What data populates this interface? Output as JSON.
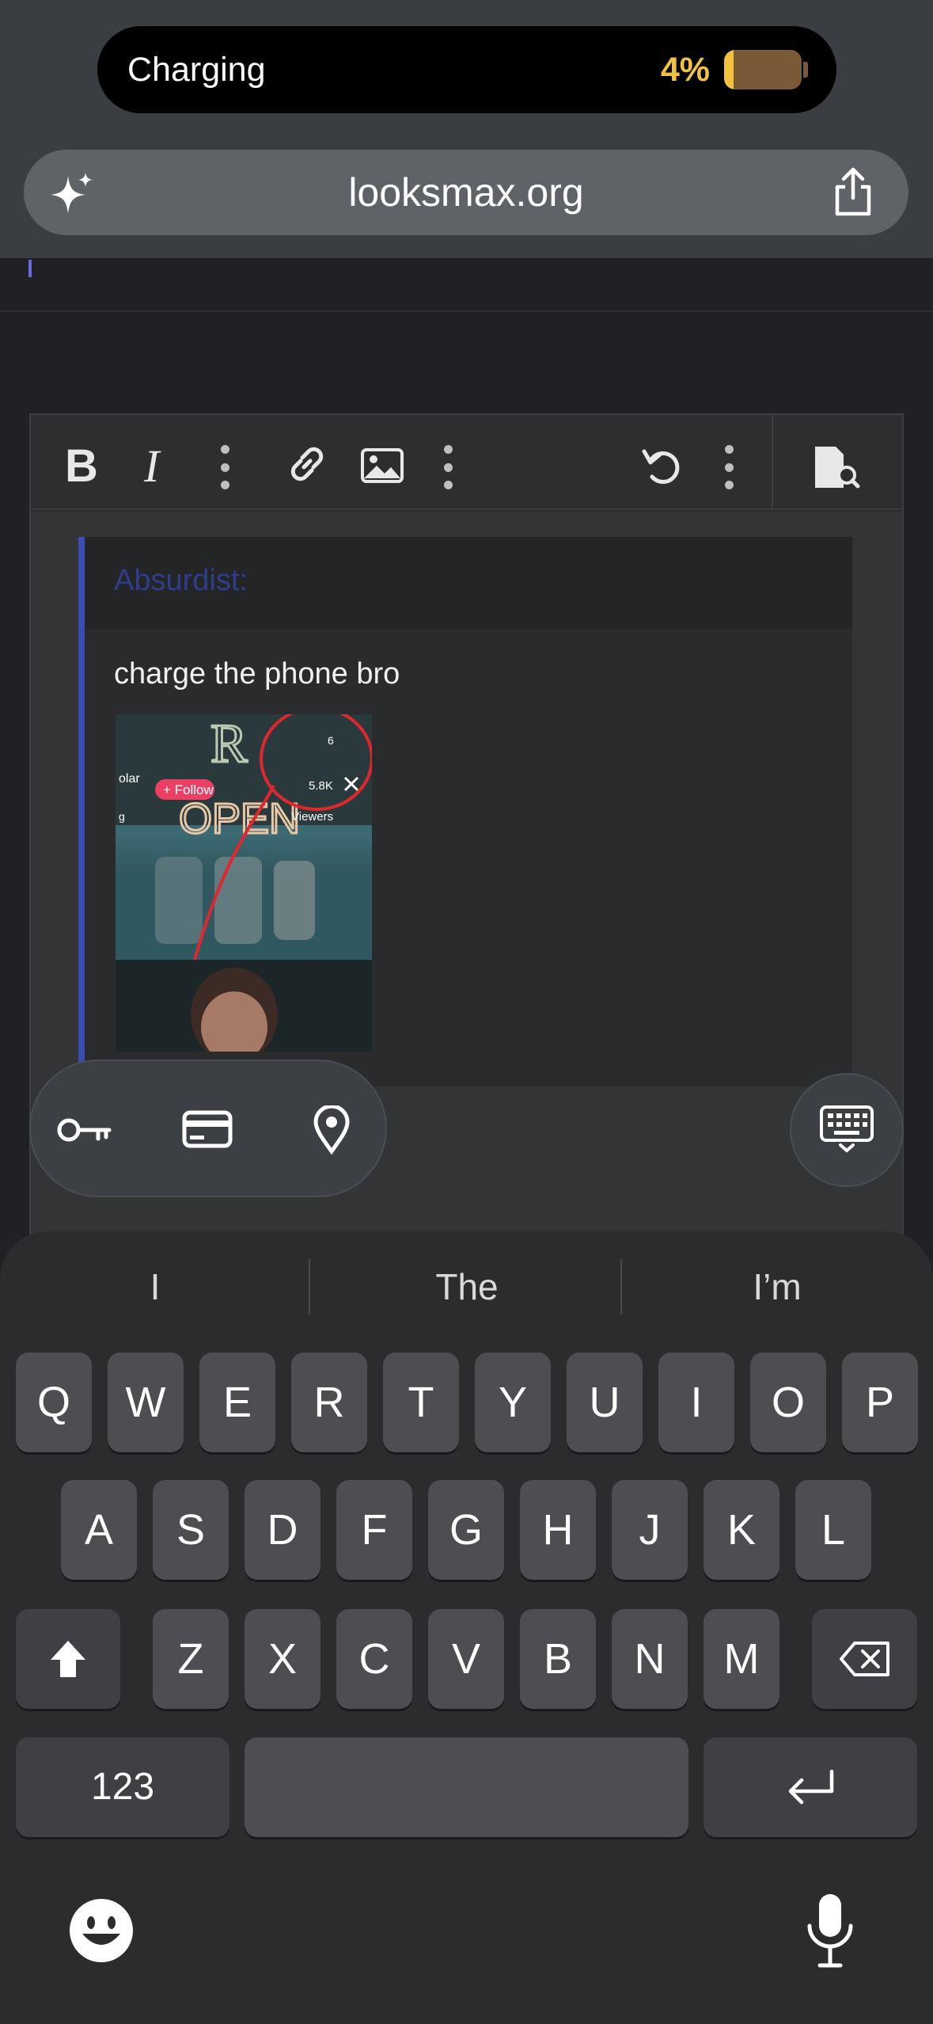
{
  "status": {
    "charging_label": "Charging",
    "battery_percent": "4%",
    "battery_level": 0.04
  },
  "browser": {
    "url": "looksmax.org"
  },
  "editor": {
    "quote_author": "Absurdist:",
    "quote_text": "charge the phone bro",
    "image_overlay": {
      "follow_label": "+ Follow",
      "viewers_count": "5.8K",
      "viewers_label": "Viewers",
      "user_fragment": "olar",
      "tag_fragment": "g",
      "status_signal": "6"
    }
  },
  "keyboard": {
    "suggestions": [
      "I",
      "The",
      "I’m"
    ],
    "row1": [
      "Q",
      "W",
      "E",
      "R",
      "T",
      "Y",
      "U",
      "I",
      "O",
      "P"
    ],
    "row2": [
      "A",
      "S",
      "D",
      "F",
      "G",
      "H",
      "J",
      "K",
      "L"
    ],
    "row3": [
      "Z",
      "X",
      "C",
      "V",
      "B",
      "N",
      "M"
    ],
    "numbers_label": "123"
  },
  "colors": {
    "accent_battery": "#f3c23c",
    "quote_bar": "#3c4fb0",
    "keyboard_bg": "#2b2c2e"
  },
  "icons": [
    "sparkle-icon",
    "share-icon",
    "bold-icon",
    "italic-icon",
    "more-icon",
    "link-icon",
    "image-icon",
    "undo-icon",
    "preview-icon",
    "key-icon",
    "card-icon",
    "location-icon",
    "keyboard-icon",
    "shift-icon",
    "backspace-icon",
    "return-icon",
    "emoji-icon",
    "mic-icon"
  ]
}
